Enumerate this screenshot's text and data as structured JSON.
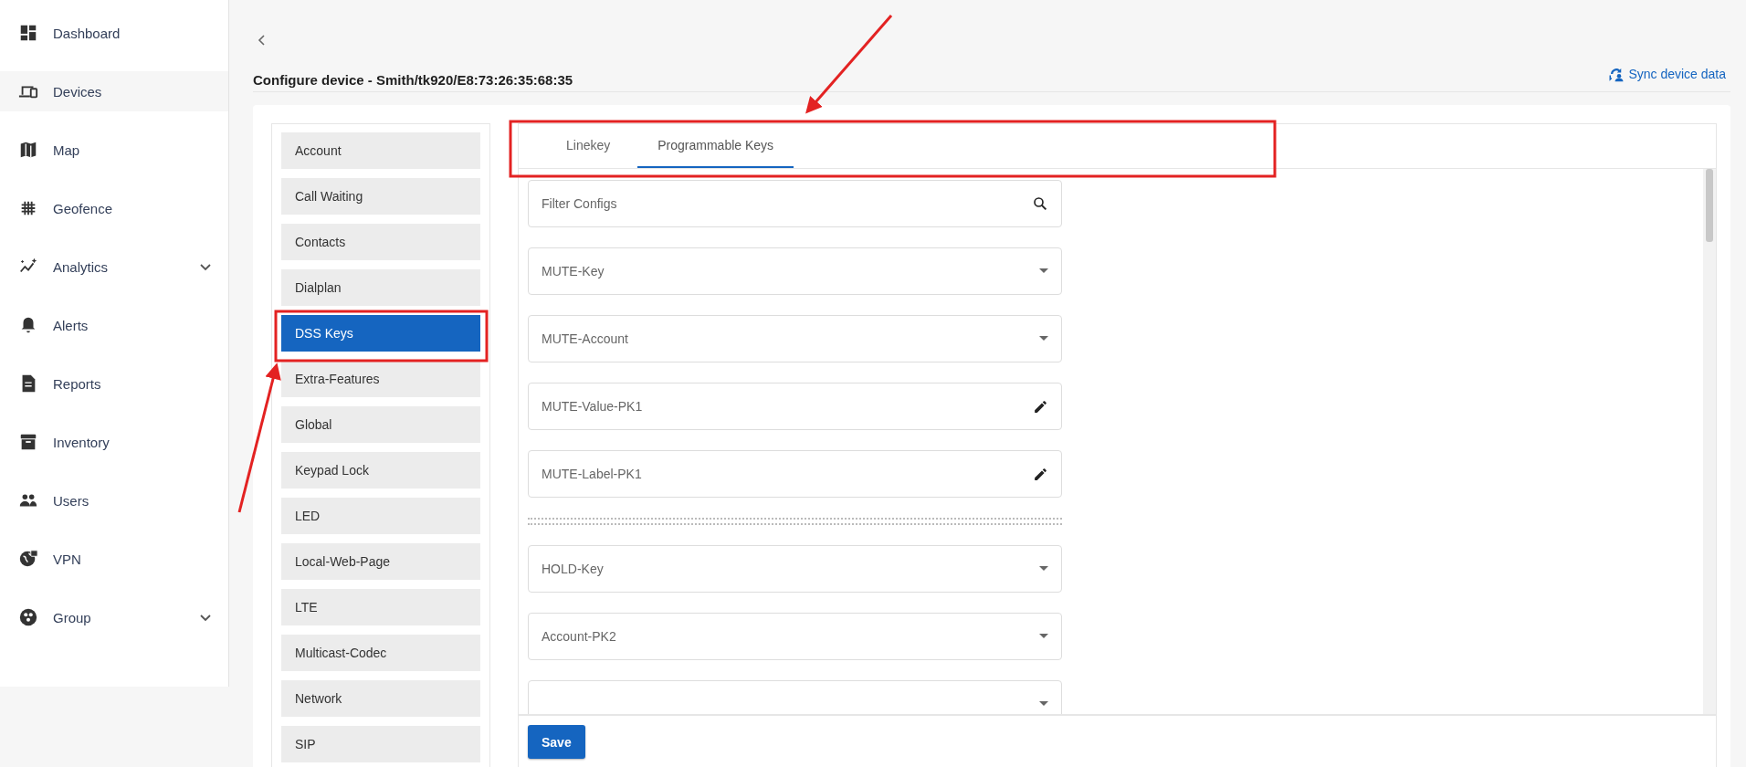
{
  "sidebar": {
    "items": [
      {
        "label": "Dashboard",
        "selected": false,
        "expandable": false
      },
      {
        "label": "Devices",
        "selected": true,
        "expandable": false
      },
      {
        "label": "Map",
        "selected": false,
        "expandable": false
      },
      {
        "label": "Geofence",
        "selected": false,
        "expandable": false
      },
      {
        "label": "Analytics",
        "selected": false,
        "expandable": true
      },
      {
        "label": "Alerts",
        "selected": false,
        "expandable": false
      },
      {
        "label": "Reports",
        "selected": false,
        "expandable": false
      },
      {
        "label": "Inventory",
        "selected": false,
        "expandable": false
      },
      {
        "label": "Users",
        "selected": false,
        "expandable": false
      },
      {
        "label": "VPN",
        "selected": false,
        "expandable": false
      },
      {
        "label": "Group",
        "selected": false,
        "expandable": true
      }
    ]
  },
  "header": {
    "title": "Configure device - Smith/tk920/E8:73:26:35:68:35",
    "sync_link": "Sync device data"
  },
  "config_menu": {
    "items": [
      {
        "label": "Account",
        "selected": false
      },
      {
        "label": "Call Waiting",
        "selected": false
      },
      {
        "label": "Contacts",
        "selected": false
      },
      {
        "label": "Dialplan",
        "selected": false
      },
      {
        "label": "DSS Keys",
        "selected": true
      },
      {
        "label": "Extra-Features",
        "selected": false
      },
      {
        "label": "Global",
        "selected": false
      },
      {
        "label": "Keypad Lock",
        "selected": false
      },
      {
        "label": "LED",
        "selected": false
      },
      {
        "label": "Local-Web-Page",
        "selected": false
      },
      {
        "label": "LTE",
        "selected": false
      },
      {
        "label": "Multicast-Codec",
        "selected": false
      },
      {
        "label": "Network",
        "selected": false
      },
      {
        "label": "SIP",
        "selected": false
      }
    ]
  },
  "tabs": [
    {
      "label": "Linekey",
      "selected": false
    },
    {
      "label": "Programmable Keys",
      "selected": true
    }
  ],
  "form": {
    "fields": [
      {
        "kind": "search",
        "placeholder": "Filter Configs"
      },
      {
        "kind": "select",
        "placeholder": "MUTE-Key"
      },
      {
        "kind": "select",
        "placeholder": "MUTE-Account"
      },
      {
        "kind": "text",
        "placeholder": "MUTE-Value-PK1"
      },
      {
        "kind": "text",
        "placeholder": "MUTE-Label-PK1"
      },
      {
        "kind": "separator"
      },
      {
        "kind": "select",
        "placeholder": "HOLD-Key"
      },
      {
        "kind": "select",
        "placeholder": "Account-PK2"
      },
      {
        "kind": "select"
      }
    ],
    "save_button": "Save"
  }
}
